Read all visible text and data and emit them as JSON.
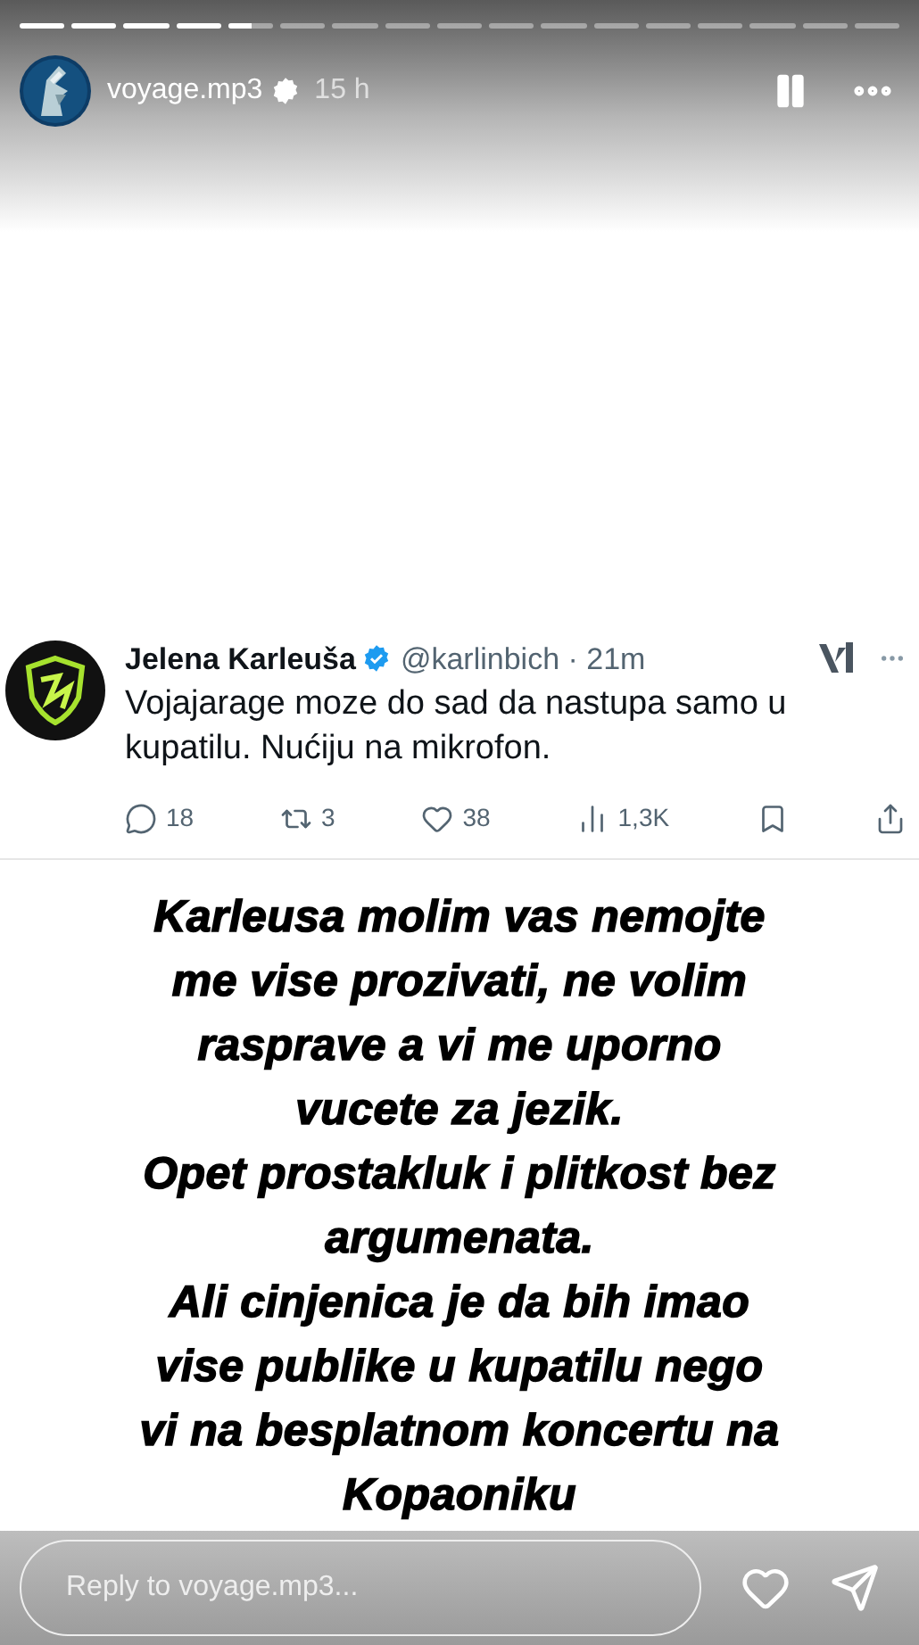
{
  "progress": [
    {
      "kind": "viewed"
    },
    {
      "kind": "viewed"
    },
    {
      "kind": "viewed"
    },
    {
      "kind": "viewed"
    },
    {
      "kind": "current",
      "level": 0.5
    },
    {
      "kind": "upcoming"
    },
    {
      "kind": "upcoming"
    },
    {
      "kind": "upcoming"
    },
    {
      "kind": "upcoming"
    },
    {
      "kind": "upcoming"
    },
    {
      "kind": "upcoming"
    },
    {
      "kind": "upcoming"
    },
    {
      "kind": "upcoming"
    },
    {
      "kind": "upcoming"
    },
    {
      "kind": "upcoming"
    },
    {
      "kind": "upcoming"
    },
    {
      "kind": "upcoming"
    }
  ],
  "header": {
    "username": "voyage.mp3",
    "verified": true,
    "time": "15 h"
  },
  "tweet": {
    "name": "Jelena Karleuša",
    "verified": true,
    "handle": "@karlinbich · 21m",
    "text": "Vojajarage moze do sad da nastupa samo u kupatilu. Nućiju na mikrofon.",
    "stats": [
      {
        "kind": "reply",
        "count": "18"
      },
      {
        "kind": "repost",
        "count": "3"
      },
      {
        "kind": "like",
        "count": "38"
      },
      {
        "kind": "views",
        "count": "1,3K"
      },
      {
        "kind": "bookmark"
      },
      {
        "kind": "share"
      }
    ]
  },
  "caption_lines": [
    "Karleusa molim vas nemojte",
    "me vise prozivati, ne volim",
    "rasprave a vi me uporno",
    "vucete za jezik.",
    "Opet prostakluk i plitkost bez",
    "argumenata.",
    "Ali cinjenica je da bih imao",
    "vise publike u kupatilu nego",
    "vi na besplatnom koncertu na",
    "Kopaoniku"
  ],
  "reply": {
    "placeholder": "Reply to voyage.mp3..."
  }
}
